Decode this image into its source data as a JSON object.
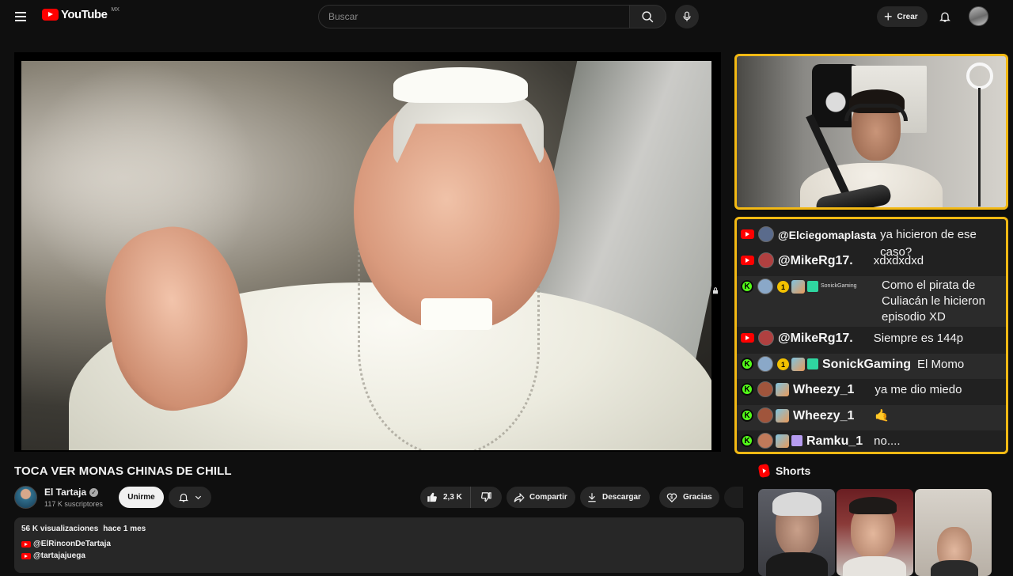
{
  "topbar": {
    "logo_text": "YouTube",
    "region": "MX",
    "search_placeholder": "Buscar",
    "create_label": "Crear"
  },
  "video": {
    "title": "TOCA VER MONAS CHINAS DE CHILL",
    "channel_name": "El Tartaja",
    "subscribers": "117 K suscriptores",
    "join_label": "Unirme",
    "likes": "2,3 K",
    "share_label": "Compartir",
    "download_label": "Descargar",
    "thanks_label": "Gracias"
  },
  "description": {
    "views": "56 K visualizaciones",
    "date": "hace 1 mes",
    "links": [
      "@ElRinconDeTartaja",
      "@tartajajuega"
    ]
  },
  "chat": {
    "messages": [
      {
        "platform": "youtube",
        "user": "@Elciegomaplasta",
        "text": "ya hicieron de ese caso?"
      },
      {
        "platform": "youtube",
        "user": "@MikeRg17.",
        "text": "xdxdxdxd"
      },
      {
        "platform": "kick",
        "badge_num": "1",
        "tiny": "SonickGaming",
        "text": "Como el pirata de Culiacán le hicieron episodio XD"
      },
      {
        "platform": "youtube",
        "user": "@MikeRg17.",
        "text": "Siempre es 144p"
      },
      {
        "platform": "kick",
        "badge_num": "1",
        "user": "SonickGaming",
        "text": "El Momo"
      },
      {
        "platform": "kick",
        "user": "Wheezy_1",
        "text": "ya me dio miedo"
      },
      {
        "platform": "kick",
        "user": "Wheezy_1",
        "text": "🤙"
      },
      {
        "platform": "kick",
        "user": "Ramku_1",
        "text": "no...."
      }
    ]
  },
  "shorts": {
    "heading": "Shorts"
  },
  "colors": {
    "accent_red": "#ff0000",
    "frame_yellow": "#f3b914",
    "kick_green": "#53fc18"
  }
}
